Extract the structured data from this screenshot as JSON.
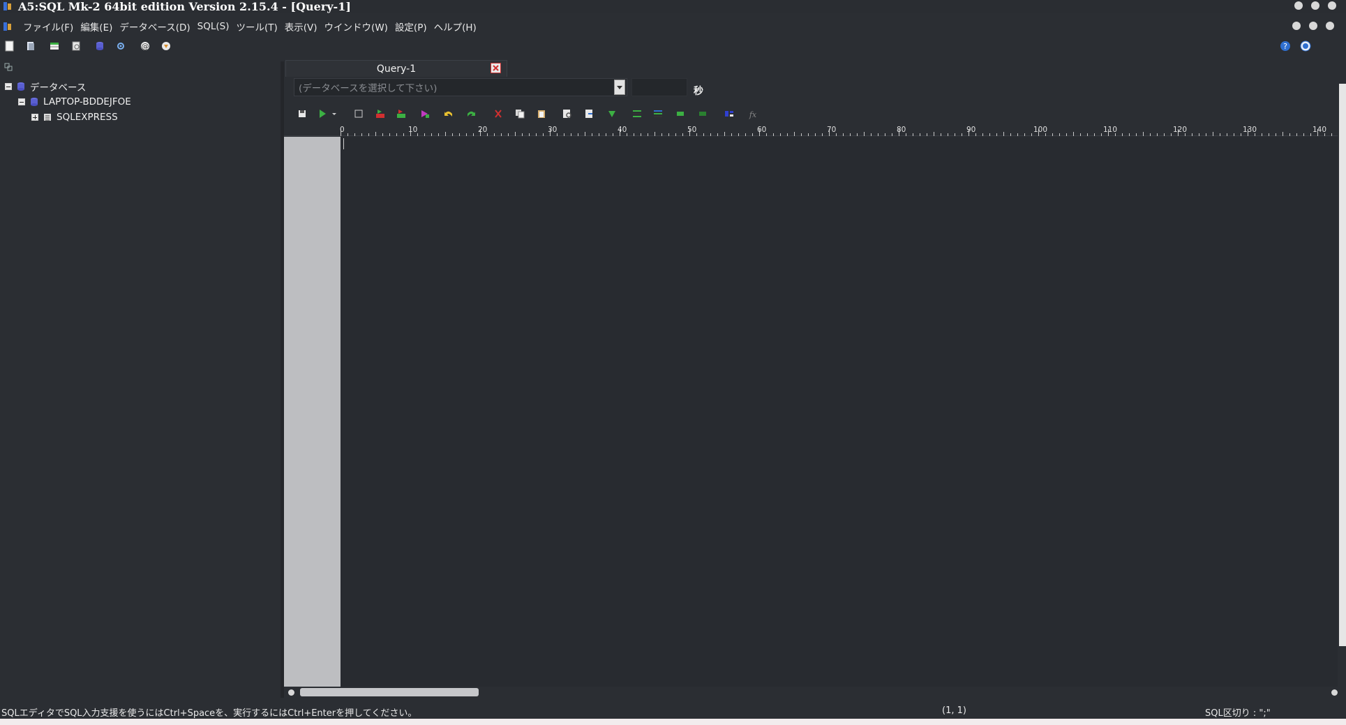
{
  "window": {
    "title": "A5:SQL Mk-2 64bit edition Version 2.15.4 - [Query-1]"
  },
  "menu": {
    "items": [
      "ファイル(F)",
      "編集(E)",
      "データベース(D)",
      "SQL(S)",
      "ツール(T)",
      "表示(V)",
      "ウインドウ(W)",
      "設定(P)",
      "ヘルプ(H)"
    ]
  },
  "tree": {
    "root_label": "データベース",
    "server_label": "LAPTOP-BDDEJFOE",
    "instance_label": "SQLEXPRESS"
  },
  "editor": {
    "tab_label": "Query-1",
    "db_select_placeholder": "(データベースを選択して下さい)",
    "timeout_value": "",
    "seconds_label": "秒",
    "ruler_labels": [
      "0",
      "10",
      "20",
      "30",
      "40",
      "50",
      "60",
      "70",
      "80",
      "90",
      "100",
      "110",
      "120",
      "130",
      "140"
    ]
  },
  "status": {
    "message": "SQLエディタでSQL入力支援を使うにはCtrl+Spaceを、実行するにはCtrl+Enterを押してください。",
    "cursor_position": "(1, 1)",
    "sql_separator": "SQL区切り : \";\""
  },
  "colors": {
    "background": "#2b2e33",
    "editor_bg": "#282b30",
    "gutter": "#bdbec1",
    "accent_green": "#3cb043",
    "accent_red": "#d03030"
  }
}
